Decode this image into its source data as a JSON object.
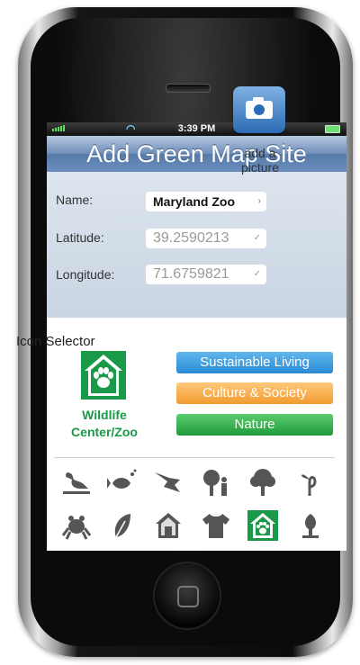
{
  "status_bar": {
    "time": "3:39 PM"
  },
  "title": "Add Green Map Site",
  "form": {
    "name_label": "Name:",
    "name_value": "Maryland Zoo",
    "latitude_label": "Latitude:",
    "latitude_value": "39.2590213",
    "longitude_label": "Longitude:",
    "longitude_value": "71.6759821",
    "add_picture_label_1": "add a",
    "add_picture_label_2": "picture"
  },
  "icon_selector": {
    "title": "Icon Selector",
    "selected_name_1": "Wildlife",
    "selected_name_2": "Center/Zoo",
    "categories": [
      "Sustainable Living",
      "Culture & Society",
      "Nature"
    ]
  },
  "colors": {
    "title_bar": "#6d8db8",
    "selected_green": "#1a9a48",
    "sustainable": "#2b8ad6",
    "culture": "#f19a2f",
    "nature": "#1f9a3c"
  },
  "icon_grid": [
    "bird-icon",
    "fish-icon",
    "flying-bird-icon",
    "tree-person-icon",
    "tree-icon",
    "sprout-icon",
    "frog-icon",
    "leaf-icon",
    "house-icon",
    "tshirt-icon",
    "paw-house-icon",
    "seedling-icon"
  ]
}
